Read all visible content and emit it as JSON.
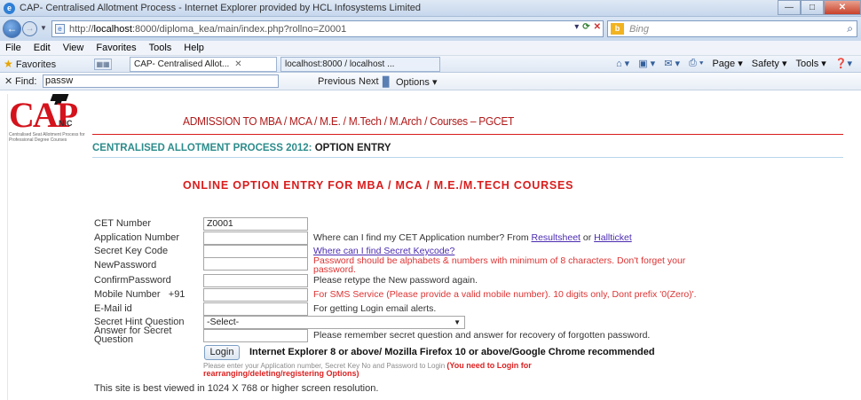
{
  "window": {
    "title": "CAP- Centralised Allotment Process - Internet Explorer provided by HCL Infosystems Limited",
    "controls": {
      "minimize": "—",
      "maximize": "□",
      "close": "✕"
    }
  },
  "address": {
    "url_prefix": "http://",
    "url_host": "localhost",
    "url_rest": ":8000/diploma_kea/main/index.php?rollno=Z0001",
    "search_engine": "Bing"
  },
  "menu": [
    "File",
    "Edit",
    "View",
    "Favorites",
    "Tools",
    "Help"
  ],
  "favorites_bar": {
    "favorites_label": "Favorites",
    "tabs": [
      "CAP- Centralised Allot...",
      "localhost:8000 / localhost ..."
    ],
    "tools": [
      "Page ▾",
      "Safety ▾",
      "Tools ▾"
    ]
  },
  "find_bar": {
    "label": "Find:",
    "query": "passw",
    "previous": "Previous",
    "next": "Next",
    "options": "Options ▾"
  },
  "page": {
    "logo_text": "CAP",
    "logo_nic": "NIC",
    "logo_sub": "Centralised Seat Allotment Process for Professional Degree Courses",
    "heading": "ADMISSION TO MBA / MCA / M.E. / M.Tech / M.Arch / Courses – PGCET",
    "cap_title_main": "CENTRALISED ALLOTMENT PROCESS 2012:",
    "cap_title_sub": "OPTION ENTRY",
    "subheading": "ONLINE OPTION ENTRY FOR MBA / MCA / M.E./M.TECH COURSES",
    "form": {
      "cet_label": "CET Number",
      "cet_value": "Z0001",
      "app_label": "Application Number",
      "app_hint": "Where can I find my CET Application number? From",
      "app_link1": "Resultsheet",
      "app_or": "or",
      "app_link2": "Hallticket",
      "key_label": "Secret Key Code",
      "key_link": "Where can I find Secret Keycode?",
      "newpw_label": "NewPassword",
      "newpw_hint1": "Password should be alphabets & numbers with minimum of 8 characters. Don't forget your",
      "newpw_hint2": "password.",
      "confirm_label": "ConfirmPassword",
      "confirm_hint": "Please retype the New password again.",
      "mobile_label": "Mobile Number",
      "mobile_prefix": "+91",
      "mobile_hint": "For SMS Service (Please provide a valid mobile number). 10 digits only, Dont prefix '0(Zero)'.",
      "email_label": "E-Mail id",
      "email_hint": "For getting Login email alerts.",
      "hint_q_label": "Secret Hint Question",
      "hint_q_value": "-Select-",
      "answer_label1": "Answer for Secret",
      "answer_label2": "Question",
      "answer_hint": "Please remember secret question and answer for recovery of forgotten password.",
      "login_button": "Login",
      "browser_rec": "Internet Explorer 8 or above/ Mozilla Firefox 10 or above/Google Chrome recommended",
      "login_note": "Please enter your Application number, Secret Key No and Password to Login",
      "login_note_red1": "(You need to Login for",
      "login_note_red2": "rearranging/deleting/registering Options)",
      "best_viewed": "This site is best viewed in 1024 X 768 or higher screen resolution."
    }
  }
}
